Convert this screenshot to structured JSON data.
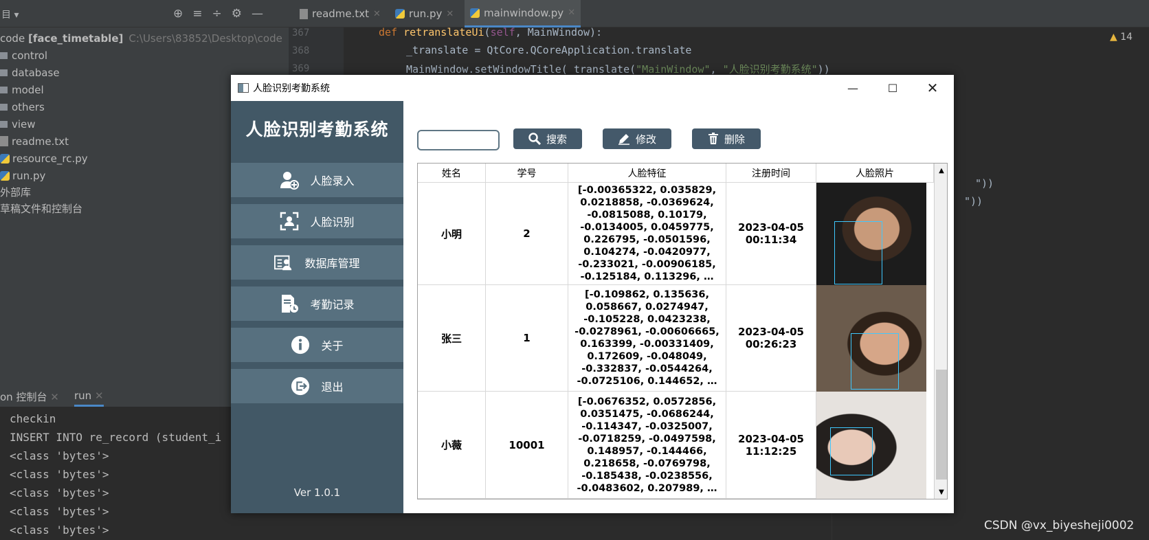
{
  "ide": {
    "tabs": [
      {
        "label": "readme.txt"
      },
      {
        "label": "run.py"
      },
      {
        "label": "mainwindow.py"
      }
    ],
    "project": {
      "root_name": "code",
      "root_module": "[face_timetable]",
      "root_path": "C:\\Users\\83852\\Desktop\\code",
      "items": [
        "control",
        "database",
        "model",
        "others",
        "view",
        "readme.txt",
        "resource_rc.py",
        "run.py",
        "外部库",
        "草稿文件和控制台"
      ]
    },
    "code": {
      "line_numbers": [
        "367",
        "368",
        "369"
      ],
      "line1_def": "def ",
      "line1_fn": "retranslateUi",
      "line1_open": "(",
      "line1_self": "self",
      "line1_rest": ", MainWindow):",
      "line2": "_translate = QtCore.QCoreApplication.translate",
      "line3_pre": "MainWindow.setWindowTitle(_translate(",
      "line3_s1": "\"MainWindow\"",
      "line3_mid": ", ",
      "line3_s2": "\"人脸识别考勤系统\"",
      "line3_end": "))",
      "frag1": "\"))",
      "frag2": "\"))"
    },
    "warnings_count": "14",
    "console": {
      "tab1": "on 控制台",
      "tab2": "run",
      "lines": [
        "checkin",
        "INSERT INTO re_record (student_i",
        "<class 'bytes'>",
        "<class 'bytes'>",
        "<class 'bytes'>",
        "<class 'bytes'>",
        "<class 'bytes'>"
      ]
    },
    "watermark": "CSDN @vx_biyesheji0002"
  },
  "app": {
    "window_title": "人脸识别考勤系统",
    "sidebar_title": "人脸识别考勤系统",
    "nav": [
      {
        "label": "人脸录入",
        "icon": "face-enroll-icon"
      },
      {
        "label": "人脸识别",
        "icon": "face-scan-icon"
      },
      {
        "label": "数据库管理",
        "icon": "database-manage-icon"
      },
      {
        "label": "考勤记录",
        "icon": "attendance-record-icon"
      },
      {
        "label": "关于",
        "icon": "info-icon"
      },
      {
        "label": "退出",
        "icon": "exit-icon"
      }
    ],
    "version": "Ver 1.0.1",
    "search": {
      "value": "",
      "placeholder": ""
    },
    "buttons": {
      "search": "搜索",
      "edit": "修改",
      "delete": "删除"
    },
    "table": {
      "headers": [
        "姓名",
        "学号",
        "人脸特征",
        "注册时间",
        "人脸照片"
      ],
      "rows": [
        {
          "name": "小明",
          "id": "2",
          "feature": "[-0.00365322, 0.035829, 0.0218858, -0.0369624, -0.0815088, 0.10179, -0.0134005, 0.0459775, 0.226795, -0.0501596, 0.104274, -0.0420977, -0.233021, -0.00906185, -0.125184, 0.113296, …",
          "time": "2023-04-05 00:11:34",
          "photo": "male-face-photo-1"
        },
        {
          "name": "张三",
          "id": "1",
          "feature": "[-0.109862, 0.135636, 0.058667, 0.0274947, -0.105228, 0.0423238, -0.0278961, -0.00606665, 0.163399, -0.00331409, 0.172609, -0.048049, -0.332837, -0.0544264, -0.0725106, 0.144652, …",
          "time": "2023-04-05 00:26:23",
          "photo": "male-face-photo-2"
        },
        {
          "name": "小薇",
          "id": "10001",
          "feature": "[-0.0676352, 0.0572856, 0.0351475, -0.0686244, -0.114347, -0.0325007, -0.0718259, -0.0497598, 0.148957, -0.144466, 0.218658, -0.0769798, -0.185438, -0.0238556, -0.0483602, 0.207989, …",
          "time": "2023-04-05 11:12:25",
          "photo": "female-face-photo"
        }
      ]
    }
  }
}
